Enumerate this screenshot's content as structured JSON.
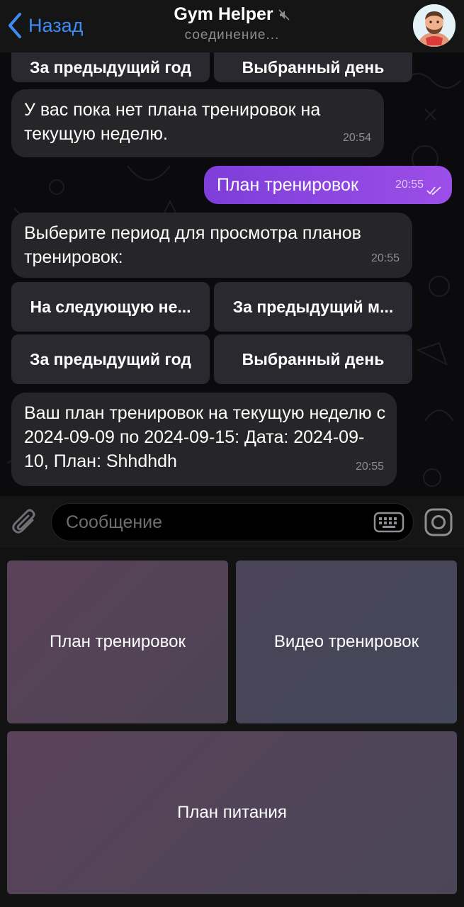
{
  "header": {
    "back_label": "Назад",
    "title": "Gym Helper",
    "status": "соединение..."
  },
  "messages": {
    "m1_text": "У вас пока нет плана тренировок на текущую неделю.",
    "m1_time": "20:54",
    "m2_text": "План тренировок",
    "m2_time": "20:55",
    "m3_text": "Выберите период для просмотра планов тренировок:",
    "m3_time": "20:55",
    "m4_text": "Ваш план тренировок на текущую неделю с 2024-09-09 по 2024-09-15: Дата: 2024-09-10, План: Shhdhdh",
    "m4_time": "20:55"
  },
  "inline_top": {
    "left": "За предыдущий год",
    "right": "Выбранный день"
  },
  "inline_keyboard": {
    "next_week": "На следующую не...",
    "prev_month": "За предыдущий м...",
    "prev_year": "За предыдущий год",
    "selected_day": "Выбранный день"
  },
  "input": {
    "placeholder": "Сообщение"
  },
  "reply_keyboard": {
    "workout_plan": "План тренировок",
    "workout_video": "Видео тренировок",
    "nutrition_plan": "План питания"
  },
  "colors": {
    "accent": "#3d8bf5",
    "outgoing_bubble": "#8b45e0",
    "incoming_bubble": "#262528"
  }
}
